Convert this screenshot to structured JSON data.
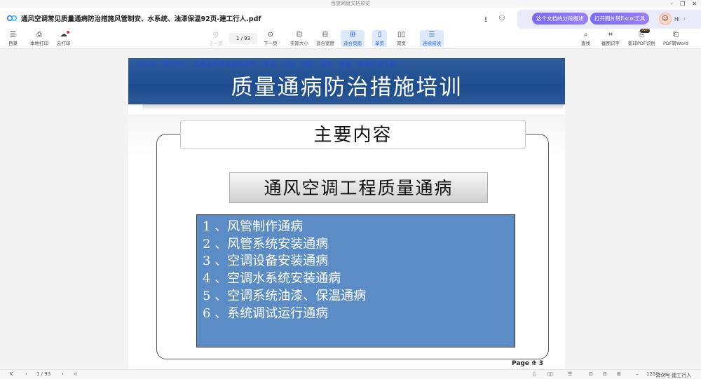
{
  "window": {
    "title": "百度网盘文档预览",
    "minimize": "–",
    "restore": "❐",
    "close": "✕"
  },
  "file": {
    "name": "通风空调常见质量通病防治措施风管制安、水系统、油漆保温92页-建工行人.pdf"
  },
  "header": {
    "download_icon": "⭳",
    "share_icon": "⚇",
    "promo_pill_1": "这个文档的分段概述",
    "promo_pill_2": "打开图片转Excel工具",
    "avatar_icon": "☺",
    "greeting": "Hi",
    "chevron": "›"
  },
  "toolbar": {
    "left": [
      {
        "icon": "☰",
        "label": "目录"
      },
      {
        "icon": "⎙",
        "label": "本地打印"
      },
      {
        "icon": "☁",
        "label": "云打印"
      }
    ],
    "prev_page": {
      "icon": "⊙",
      "label": "上一页"
    },
    "page_indicator": "1 / 93",
    "next_page": {
      "icon": "⊙",
      "label": "下一页"
    },
    "view": [
      {
        "icon": "⊡",
        "label": "实际大小"
      },
      {
        "icon": "⊟",
        "label": "适合宽度"
      },
      {
        "icon": "⊞",
        "label": "适合页面"
      },
      {
        "icon": "▯",
        "label": "单页"
      },
      {
        "icon": "▯▯",
        "label": "双页"
      },
      {
        "icon": "☰",
        "label": "连续阅读"
      }
    ],
    "right": [
      {
        "icon": "⌕",
        "label": "查找"
      },
      {
        "icon": "⌗",
        "label": "截图识字"
      },
      {
        "icon": "⎘",
        "label": "影印PDF识别"
      },
      {
        "icon": "⎗",
        "label": "PDF转Word"
      }
    ],
    "svip_badge": "SVIP"
  },
  "document": {
    "watermark": "公众号：建工行人，免费提供考试相关资料，资讯，口诀，习题，试卷，押题，等等欢迎下载！",
    "banner_title": "质量通病防治措施培训",
    "main_heading": "主要内容",
    "sub_heading": "通风空调工程质量通病",
    "items": [
      "1 、风管制作通病",
      "2 、风管系统安装通病",
      "3 、空调设备安装通病",
      "4 、空调水系统安装通病",
      "5 、空调系统油漆、保温通病",
      "6 、系统调试运行通病"
    ],
    "page_number": "Page ",
    "page_number_icon": "⟰",
    "page_number_value": "3"
  },
  "statusbar": {
    "first": "K",
    "prev": "‹",
    "page": "1 / 93",
    "next": "›",
    "last": "›I",
    "zoom": "125%",
    "zoom_minus": "–",
    "zoom_plus": "+",
    "corner": "公众号·建工行人"
  },
  "colors": {
    "accent": "#2a62d8",
    "banner": "#1e4d8f",
    "list_bg": "#5b8cc6",
    "promo": "#7a6cf0"
  }
}
